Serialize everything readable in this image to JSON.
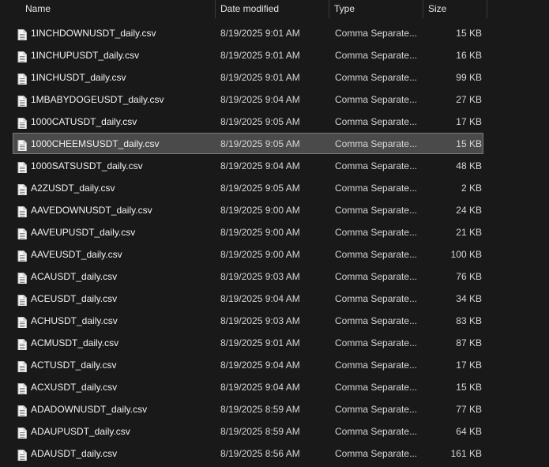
{
  "columns": {
    "name": "Name",
    "date_modified": "Date modified",
    "type": "Type",
    "size": "Size",
    "sort_indicator": "^"
  },
  "files": [
    {
      "name": "1INCHDOWNUSDT_daily.csv",
      "date": "8/19/2025 9:01 AM",
      "type": "Comma Separate...",
      "size": "15 KB"
    },
    {
      "name": "1INCHUPUSDT_daily.csv",
      "date": "8/19/2025 9:01 AM",
      "type": "Comma Separate...",
      "size": "16 KB"
    },
    {
      "name": "1INCHUSDT_daily.csv",
      "date": "8/19/2025 9:01 AM",
      "type": "Comma Separate...",
      "size": "99 KB"
    },
    {
      "name": "1MBABYDOGEUSDT_daily.csv",
      "date": "8/19/2025 9:04 AM",
      "type": "Comma Separate...",
      "size": "27 KB"
    },
    {
      "name": "1000CATUSDT_daily.csv",
      "date": "8/19/2025 9:05 AM",
      "type": "Comma Separate...",
      "size": "17 KB"
    },
    {
      "name": "1000CHEEMSUSDT_daily.csv",
      "date": "8/19/2025 9:05 AM",
      "type": "Comma Separate...",
      "size": "15 KB",
      "selected": true
    },
    {
      "name": "1000SATSUSDT_daily.csv",
      "date": "8/19/2025 9:04 AM",
      "type": "Comma Separate...",
      "size": "48 KB"
    },
    {
      "name": "A2ZUSDT_daily.csv",
      "date": "8/19/2025 9:05 AM",
      "type": "Comma Separate...",
      "size": "2 KB"
    },
    {
      "name": "AAVEDOWNUSDT_daily.csv",
      "date": "8/19/2025 9:00 AM",
      "type": "Comma Separate...",
      "size": "24 KB"
    },
    {
      "name": "AAVEUPUSDT_daily.csv",
      "date": "8/19/2025 9:00 AM",
      "type": "Comma Separate...",
      "size": "21 KB"
    },
    {
      "name": "AAVEUSDT_daily.csv",
      "date": "8/19/2025 9:00 AM",
      "type": "Comma Separate...",
      "size": "100 KB"
    },
    {
      "name": "ACAUSDT_daily.csv",
      "date": "8/19/2025 9:03 AM",
      "type": "Comma Separate...",
      "size": "76 KB"
    },
    {
      "name": "ACEUSDT_daily.csv",
      "date": "8/19/2025 9:04 AM",
      "type": "Comma Separate...",
      "size": "34 KB"
    },
    {
      "name": "ACHUSDT_daily.csv",
      "date": "8/19/2025 9:03 AM",
      "type": "Comma Separate...",
      "size": "83 KB"
    },
    {
      "name": "ACMUSDT_daily.csv",
      "date": "8/19/2025 9:01 AM",
      "type": "Comma Separate...",
      "size": "87 KB"
    },
    {
      "name": "ACTUSDT_daily.csv",
      "date": "8/19/2025 9:04 AM",
      "type": "Comma Separate...",
      "size": "17 KB"
    },
    {
      "name": "ACXUSDT_daily.csv",
      "date": "8/19/2025 9:04 AM",
      "type": "Comma Separate...",
      "size": "15 KB"
    },
    {
      "name": "ADADOWNUSDT_daily.csv",
      "date": "8/19/2025 8:59 AM",
      "type": "Comma Separate...",
      "size": "77 KB"
    },
    {
      "name": "ADAUPUSDT_daily.csv",
      "date": "8/19/2025 8:59 AM",
      "type": "Comma Separate...",
      "size": "64 KB"
    },
    {
      "name": "ADAUSDT_daily.csv",
      "date": "8/19/2025 8:56 AM",
      "type": "Comma Separate...",
      "size": "161 KB"
    }
  ],
  "icons": {
    "file": "document-file-icon"
  },
  "colors": {
    "background": "#191919",
    "selection": "#4a4a4a",
    "selection_border": "#7a7a7a",
    "text": "#f2f2f2"
  }
}
